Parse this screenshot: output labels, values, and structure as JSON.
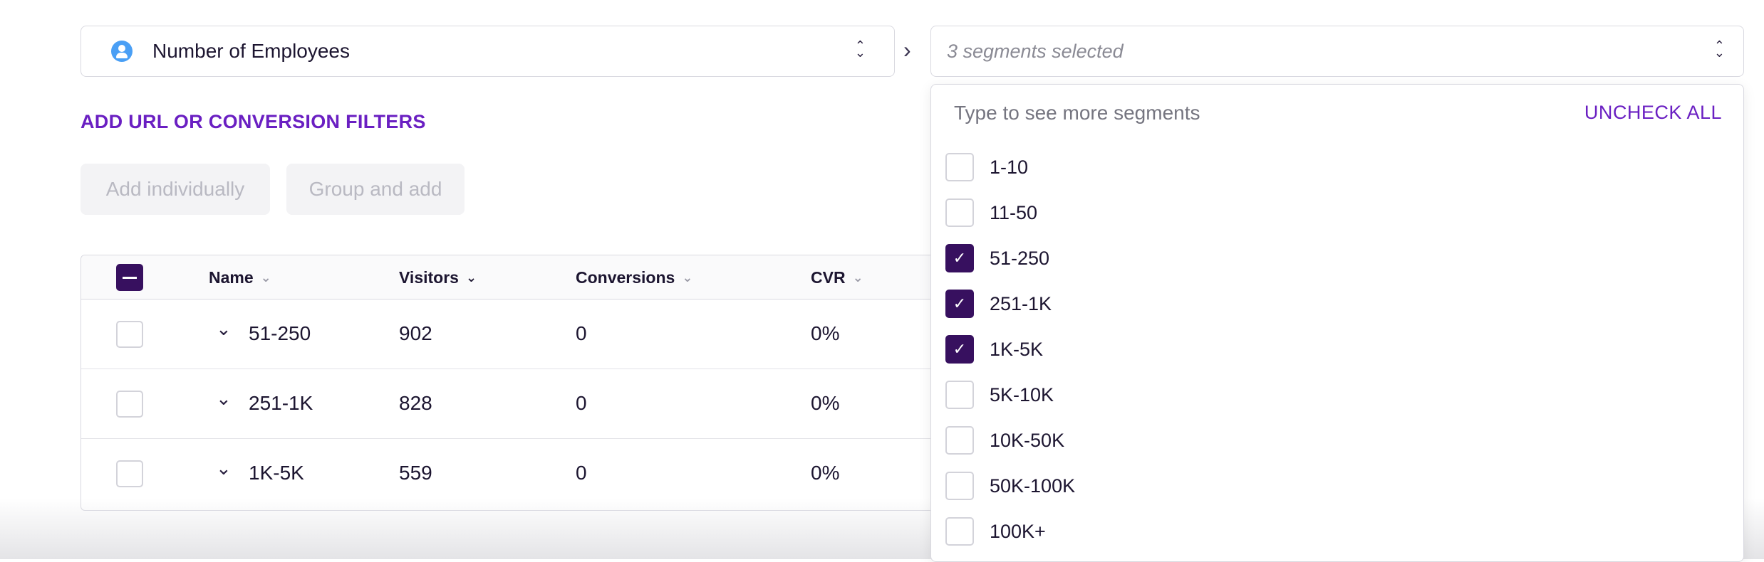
{
  "segment_select": {
    "label": "Number of Employees",
    "icon": "user-icon"
  },
  "value_select": {
    "placeholder": "3 segments selected"
  },
  "filters_link": "ADD URL OR CONVERSION FILTERS",
  "buttons": {
    "add_individually": "Add individually",
    "group_and_add": "Group and add"
  },
  "table": {
    "headers": {
      "name": "Name",
      "visitors": "Visitors",
      "conversions": "Conversions",
      "cvr": "CVR"
    },
    "rows": [
      {
        "name": "51-250",
        "visitors": "902",
        "conversions": "0",
        "cvr": "0%"
      },
      {
        "name": "251-1K",
        "visitors": "828",
        "conversions": "0",
        "cvr": "0%"
      },
      {
        "name": "1K-5K",
        "visitors": "559",
        "conversions": "0",
        "cvr": "0%"
      }
    ]
  },
  "dropdown": {
    "search_placeholder": "Type to see more segments",
    "uncheck_all": "UNCHECK ALL",
    "options": [
      {
        "label": "1-10",
        "checked": false
      },
      {
        "label": "11-50",
        "checked": false
      },
      {
        "label": "51-250",
        "checked": true
      },
      {
        "label": "251-1K",
        "checked": true
      },
      {
        "label": "1K-5K",
        "checked": true
      },
      {
        "label": "5K-10K",
        "checked": false
      },
      {
        "label": "10K-50K",
        "checked": false
      },
      {
        "label": "50K-100K",
        "checked": false
      },
      {
        "label": "100K+",
        "checked": false
      }
    ]
  },
  "colors": {
    "accent": "#6a1fc2",
    "checkbox_fill": "#37105f",
    "icon_blue": "#4a9ff5"
  }
}
